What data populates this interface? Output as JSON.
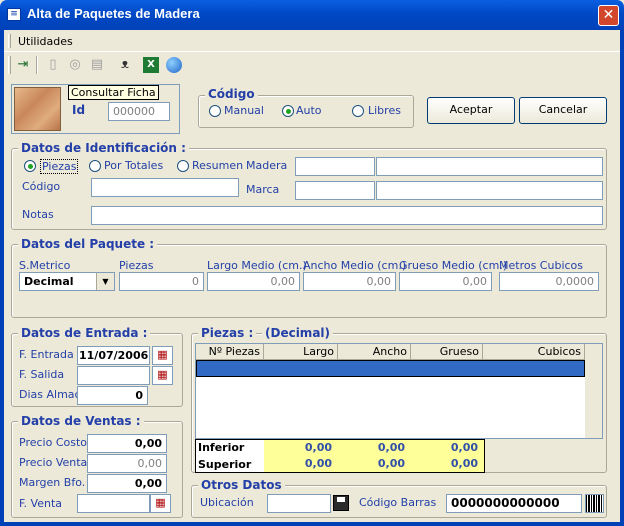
{
  "window": {
    "title": "Alta de Paquetes de Madera",
    "close": "✕"
  },
  "menu": {
    "utilidades": "Utilidades"
  },
  "toolbar": {
    "icons": [
      "exit-icon",
      "document-icon",
      "preview-icon",
      "print-icon",
      "binoculars-icon",
      "excel-icon",
      "globe-icon"
    ]
  },
  "ficha": {
    "tooltip": "Consultar Ficha",
    "id_label": "Id",
    "id_value": "000000"
  },
  "codigo": {
    "legend": "Código",
    "manual": "Manual",
    "auto": "Auto",
    "libres": "Libres",
    "selected": "auto"
  },
  "buttons": {
    "aceptar": "Aceptar",
    "cancelar": "Cancelar"
  },
  "identificacion": {
    "legend": "Datos de Identificación :",
    "piezas": "Piezas",
    "por_totales": "Por Totales",
    "resumen": "Resumen",
    "selected": "piezas",
    "madera_label": "Madera",
    "codigo_label": "Código",
    "marca_label": "Marca",
    "notas_label": "Notas",
    "madera_code": "",
    "madera_name": "",
    "codigo_value": "",
    "marca_code": "",
    "marca_name": "",
    "notas_value": ""
  },
  "paquete": {
    "legend": "Datos del Paquete :",
    "smetrico_label": "S.Metrico",
    "smetrico_value": "Decimal",
    "piezas_label": "Piezas",
    "piezas_value": "0",
    "largo_label": "Largo Medio (cm.)",
    "largo_value": "0,00",
    "ancho_label": "Ancho Medio (cm.)",
    "ancho_value": "0,00",
    "grueso_label": "Grueso Medio (cm.)",
    "grueso_value": "0,00",
    "metros_label": "Metros Cubicos",
    "metros_value": "0,0000"
  },
  "entrada": {
    "legend": "Datos de Entrada :",
    "f_entrada_label": "F. Entrada",
    "f_entrada_value": "11/07/2006",
    "f_salida_label": "F. Salida",
    "f_salida_value": "",
    "dias_label": "Dias Almac.",
    "dias_value": "0"
  },
  "ventas": {
    "legend": "Datos de Ventas :",
    "precio_costo_label": "Precio Costo",
    "precio_costo_value": "0,00",
    "precio_venta_label": "Precio Venta",
    "precio_venta_value": "0,00",
    "margen_label": "Margen Bfo.",
    "margen_value": "0,00",
    "f_venta_label": "F. Venta",
    "f_venta_value": ""
  },
  "piezas_grid": {
    "legend": "Piezas :",
    "mode": "(Decimal)",
    "columns": [
      "Nº Piezas",
      "Largo",
      "Ancho",
      "Grueso",
      "Cubicos"
    ],
    "inferior": {
      "label": "Inferior",
      "largo": "0,00",
      "ancho": "0,00",
      "grueso": "0,00"
    },
    "superior": {
      "label": "Superior",
      "largo": "0,00",
      "ancho": "0,00",
      "grueso": "0,00"
    }
  },
  "otros": {
    "legend": "Otros Datos",
    "ubicacion_label": "Ubicación",
    "ubicacion_value": "",
    "codigo_barras_label": "Código Barras",
    "codigo_barras_value": "0000000000000"
  },
  "colors": {
    "accent": "#2440A8",
    "selection": "#316AC5",
    "highlight": "#FFFF99",
    "titlebar": "#0049C6"
  }
}
